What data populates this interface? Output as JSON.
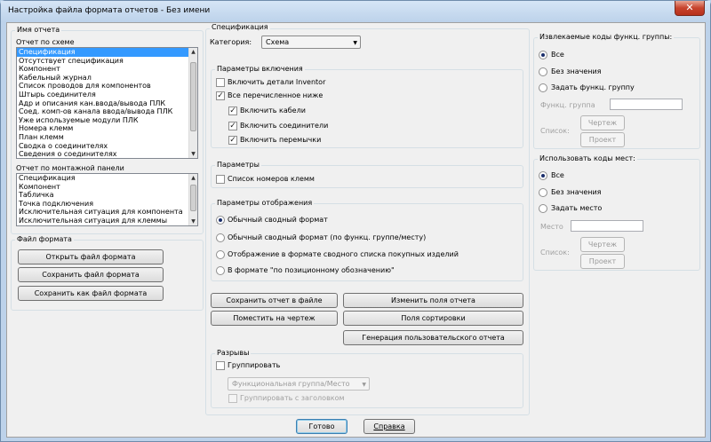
{
  "window": {
    "title": "Настройка файла формата отчетов - Без имени",
    "close_glyph": "✕"
  },
  "report_name": {
    "group_label": "Имя отчета",
    "schematic_label": "Отчет по схеме",
    "schematic_items": [
      "Спецификация",
      "Отсутствует спецификация",
      "Компонент",
      "Кабельный журнал",
      "Список проводов для компонентов",
      "Штырь соединителя",
      "Адр и описания кан.ввода/вывода ПЛК",
      "Соед. комп-ов канала ввода/вывода ПЛК",
      "Уже используемые модули ПЛК",
      "Номера клемм",
      "План клемм",
      "Сводка о соединителях",
      "Сведения о соединителях"
    ],
    "schematic_selected": 0,
    "panel_label": "Отчет по монтажной панели",
    "panel_items": [
      "Спецификация",
      "Компонент",
      "Табличка",
      "Точка подключения",
      "Исключительная ситуация для компонента",
      "Исключительная ситуация для клеммы"
    ]
  },
  "format_file": {
    "group_label": "Файл формата",
    "open": "Открыть файл формата",
    "save": "Сохранить файл формата",
    "save_as": "Сохранить как файл формата"
  },
  "spec": {
    "group_label": "Спецификация",
    "category_label": "Категория:",
    "category_value": "Схема",
    "include": {
      "group_label": "Параметры включения",
      "inventor": {
        "label": "Включить детали Inventor",
        "checked": false
      },
      "all_below": {
        "label": "Все перечисленное ниже",
        "checked": true
      },
      "cables": {
        "label": "Включить кабели",
        "checked": true
      },
      "connectors": {
        "label": "Включить соединители",
        "checked": true
      },
      "jumpers": {
        "label": "Включить перемычки",
        "checked": true
      }
    },
    "params": {
      "group_label": "Параметры",
      "terminal_numbers": {
        "label": "Список номеров клемм",
        "checked": false
      }
    },
    "display": {
      "group_label": "Параметры отображения",
      "options": [
        "Обычный сводный формат",
        "Обычный сводный формат (по функц. группе/месту)",
        "Отображение в формате сводного списка покупных изделий",
        "В формате \"по позиционному обозначению\""
      ],
      "selected": 0
    },
    "buttons": {
      "save_report": "Сохранить отчет в файле",
      "edit_fields": "Изменить поля отчета",
      "place_on_drawing": "Поместить на чертеж",
      "sort_fields": "Поля сортировки",
      "user_report": "Генерация пользовательского отчета"
    },
    "breaks": {
      "group_label": "Разрывы",
      "group": {
        "label": "Группировать",
        "checked": false
      },
      "combo_value": "Функциональная группа/Место",
      "with_header": {
        "label": "Группировать с заголовком",
        "checked": false
      }
    }
  },
  "func_codes": {
    "group_label": "Извлекаемые коды функц. группы:",
    "options": [
      "Все",
      "Без значения",
      "Задать функц. группу"
    ],
    "selected": 0,
    "func_group_label": "Функц. группа",
    "list_label": "Список:",
    "drawing_btn": "Чертеж",
    "project_btn": "Проект"
  },
  "loc_codes": {
    "group_label": "Использовать коды мест:",
    "options": [
      "Все",
      "Без значения",
      "Задать место"
    ],
    "selected": 0,
    "place_label": "Место",
    "list_label": "Список:",
    "drawing_btn": "Чертеж",
    "project_btn": "Проект"
  },
  "footer": {
    "ok": "Готово",
    "help": "Справка"
  },
  "colors": {
    "selection": "#3399ff",
    "dialog_bg": "#f0f0f0",
    "title_bg": "#bcd2ea",
    "close_red": "#c7432d"
  }
}
